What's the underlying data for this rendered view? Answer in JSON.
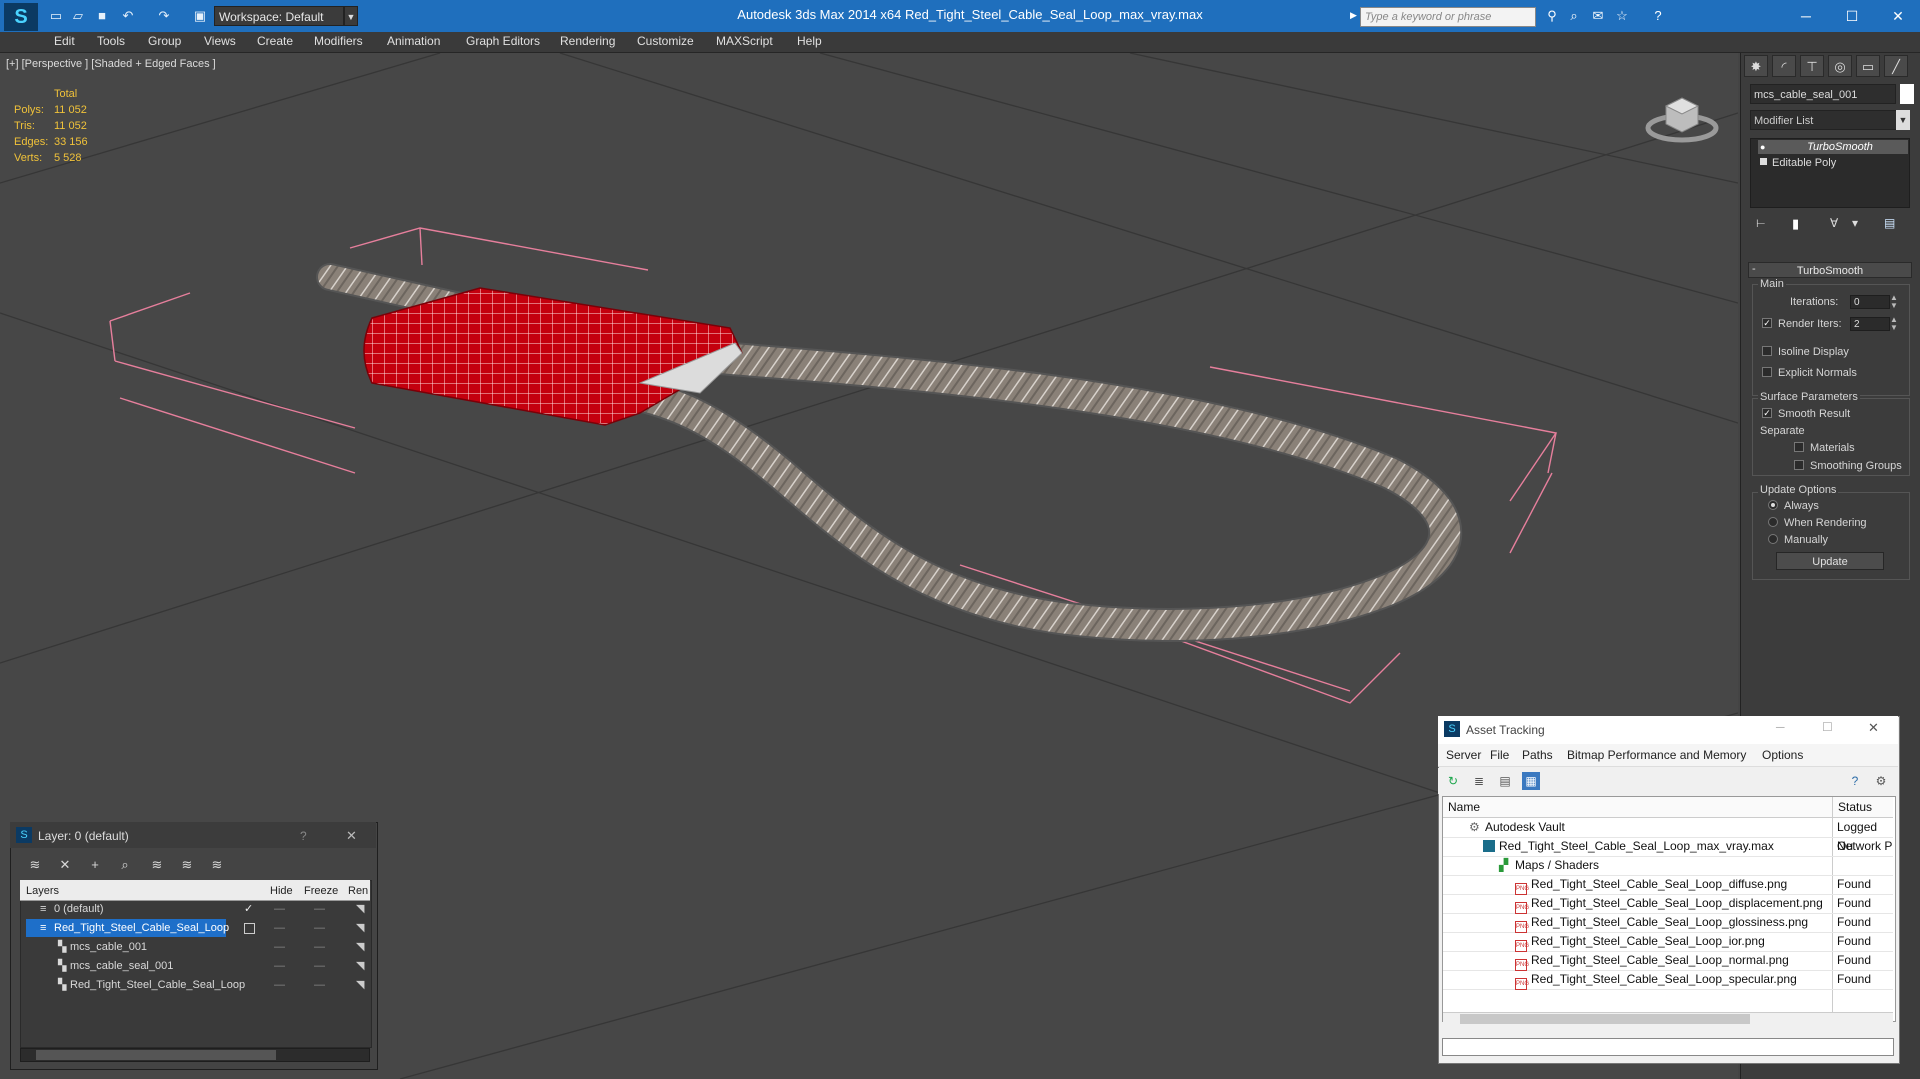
{
  "titlebar": {
    "workspace": "Workspace: Default",
    "app_title": "Autodesk 3ds Max  2014 x64      Red_Tight_Steel_Cable_Seal_Loop_max_vray.max",
    "search_placeholder": "Type a keyword or phrase",
    "accent": "#1f6fbd"
  },
  "menubar": [
    "Edit",
    "Tools",
    "Group",
    "Views",
    "Create",
    "Modifiers",
    "Animation",
    "Graph Editors",
    "Rendering",
    "Customize",
    "MAXScript",
    "Help"
  ],
  "viewport": {
    "label": "[+] [Perspective ] [Shaded + Edged Faces ]",
    "stats": {
      "header": "Total",
      "rows": [
        {
          "label": "Polys:",
          "value": "11 052"
        },
        {
          "label": "Tris:",
          "value": "11 052"
        },
        {
          "label": "Edges:",
          "value": "33 156"
        },
        {
          "label": "Verts:",
          "value": "5 528"
        }
      ]
    }
  },
  "command_panel": {
    "object_name": "mcs_cable_seal_001",
    "modifier_list": "Modifier List",
    "stack": [
      "TurboSmooth",
      "Editable Poly"
    ],
    "rollout_title": "TurboSmooth",
    "main_label": "Main",
    "iterations_label": "Iterations:",
    "iterations_value": "0",
    "render_iters_label": "Render Iters:",
    "render_iters_value": "2",
    "isoline_label": "Isoline Display",
    "explicit_normals_label": "Explicit Normals",
    "surface_params_label": "Surface Parameters",
    "smooth_result_label": "Smooth Result",
    "separate_label": "Separate",
    "materials_label": "Materials",
    "smoothing_groups_label": "Smoothing Groups",
    "update_options_label": "Update Options",
    "always_label": "Always",
    "when_rendering_label": "When Rendering",
    "manually_label": "Manually",
    "update_button": "Update"
  },
  "layer_dialog": {
    "title": "Layer: 0 (default)",
    "columns": [
      "Layers",
      "Hide",
      "Freeze",
      "Ren"
    ],
    "rows": [
      {
        "name": "0 (default)",
        "indent": 0
      },
      {
        "name": "Red_Tight_Steel_Cable_Seal_Loop",
        "indent": 0,
        "selected": true
      },
      {
        "name": "mcs_cable_001",
        "indent": 1
      },
      {
        "name": "mcs_cable_seal_001",
        "indent": 1
      },
      {
        "name": "Red_Tight_Steel_Cable_Seal_Loop",
        "indent": 1
      }
    ]
  },
  "asset_tracking": {
    "title": "Asset Tracking",
    "menu": [
      "Server",
      "File",
      "Paths",
      "Bitmap Performance and Memory",
      "Options"
    ],
    "columns": [
      "Name",
      "Status"
    ],
    "rows": [
      {
        "name": "Autodesk Vault",
        "status": "Logged Ou",
        "indent": 1
      },
      {
        "name": "Red_Tight_Steel_Cable_Seal_Loop_max_vray.max",
        "status": "Network P",
        "indent": 2
      },
      {
        "name": "Maps / Shaders",
        "status": "",
        "indent": 3
      },
      {
        "name": "Red_Tight_Steel_Cable_Seal_Loop_diffuse.png",
        "status": "Found",
        "indent": 4
      },
      {
        "name": "Red_Tight_Steel_Cable_Seal_Loop_displacement.png",
        "status": "Found",
        "indent": 4
      },
      {
        "name": "Red_Tight_Steel_Cable_Seal_Loop_glossiness.png",
        "status": "Found",
        "indent": 4
      },
      {
        "name": "Red_Tight_Steel_Cable_Seal_Loop_ior.png",
        "status": "Found",
        "indent": 4
      },
      {
        "name": "Red_Tight_Steel_Cable_Seal_Loop_normal.png",
        "status": "Found",
        "indent": 4
      },
      {
        "name": "Red_Tight_Steel_Cable_Seal_Loop_specular.png",
        "status": "Found",
        "indent": 4
      }
    ]
  }
}
